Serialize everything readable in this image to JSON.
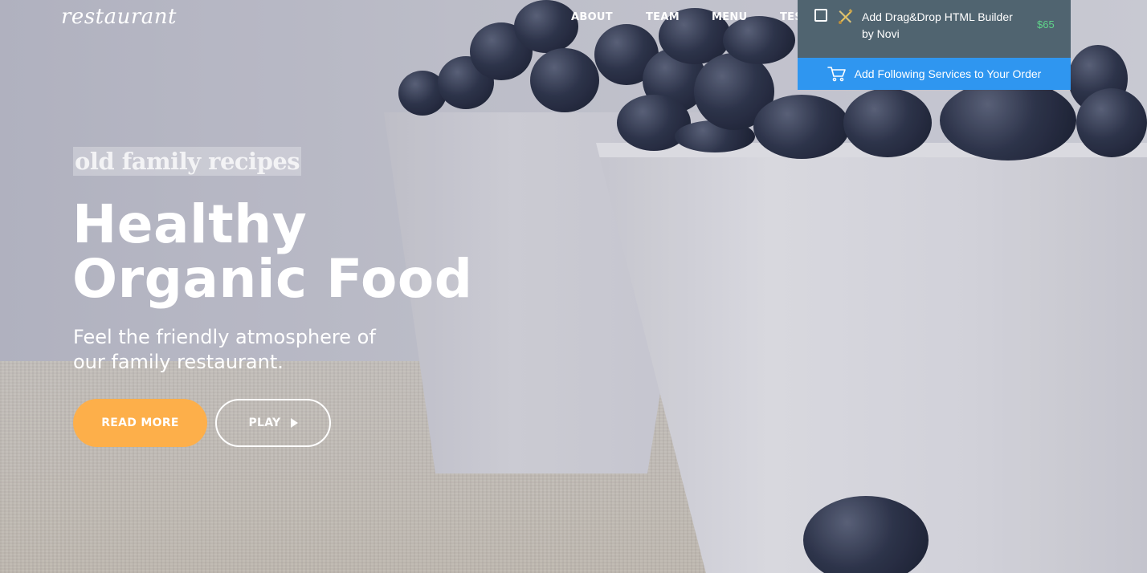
{
  "brand": {
    "logo": "restaurant"
  },
  "nav": {
    "items": [
      {
        "label": "ABOUT"
      },
      {
        "label": "TEAM"
      },
      {
        "label": "MENU"
      },
      {
        "label": "TES"
      }
    ]
  },
  "hero": {
    "tagline": "old family recipes",
    "headline_line1": "Healthy",
    "headline_line2": "Organic Food",
    "subtitle_line1": "Feel the friendly atmosphere of",
    "subtitle_line2": "our family restaurant.",
    "read_more_label": "READ MORE",
    "play_label": "PLAY"
  },
  "order_popup": {
    "checked": false,
    "item_label": "Add Drag&Drop HTML Builder by Novi",
    "item_price": "$65",
    "cta_label": "Add Following Services to Your Order",
    "colors": {
      "panel": "#506470",
      "cta": "#2f96f0",
      "price": "#5fd48a"
    },
    "icons": [
      "tools-icon",
      "cart-icon"
    ]
  },
  "colors": {
    "accent": "#fdaf4a",
    "text": "#ffffff"
  }
}
